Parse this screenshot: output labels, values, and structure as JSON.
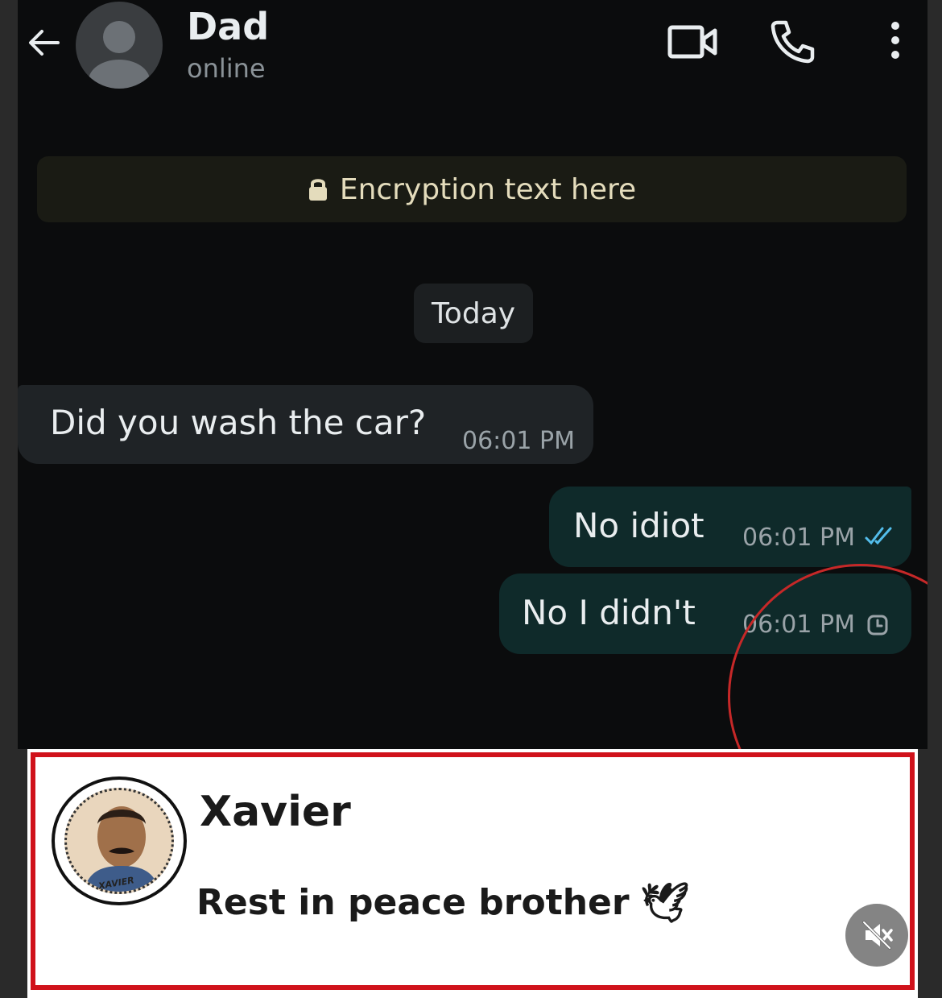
{
  "header": {
    "contact_name": "Dad",
    "status": "online",
    "icons": [
      "back-arrow-icon",
      "video-call-icon",
      "voice-call-icon",
      "more-options-icon"
    ]
  },
  "encryption_banner": {
    "text": "Encryption text here",
    "icon": "lock-icon"
  },
  "date_chip": "Today",
  "messages": [
    {
      "direction": "incoming",
      "text": "Did you wash the car?",
      "time": "06:01 PM"
    },
    {
      "direction": "outgoing",
      "text": "No idiot",
      "time": "06:01 PM",
      "status": "read"
    },
    {
      "direction": "outgoing",
      "text": "No I didn't",
      "time": "06:01 PM",
      "status": "pending"
    }
  ],
  "comment_card": {
    "commenter": "Xavier",
    "profile_caption": "XAVIER",
    "comment": "Rest in peace brother",
    "emoji": "🕊"
  },
  "colors": {
    "chat_bg": "#0b0c0d",
    "outgoing_bubble": "#0f2a2a",
    "incoming_bubble": "#1f2326",
    "read_ticks": "#53bdeb",
    "highlight_red": "#d0121b"
  }
}
